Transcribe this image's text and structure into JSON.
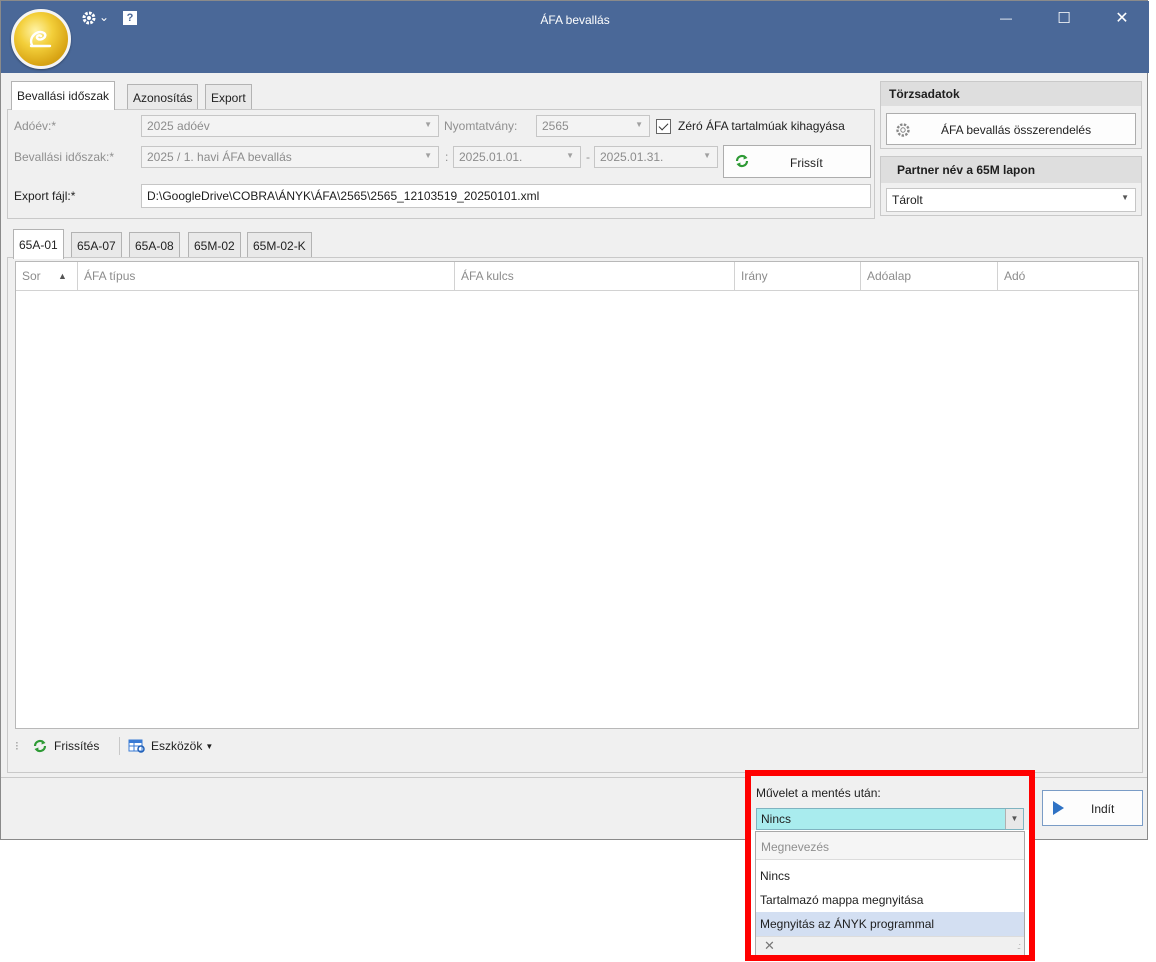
{
  "window": {
    "title": "ÁFA bevallás",
    "controls": {
      "minimize": "—",
      "maximize": "☐",
      "close": "✕"
    },
    "help_glyph": "?",
    "settings_caret": "⌄"
  },
  "top_tabs": [
    "Bevallási időszak",
    "Azonosítás",
    "Export"
  ],
  "form": {
    "adoev_label": "Adóév:*",
    "adoev_value": "2025 adóév",
    "nyomtatvany_label": "Nyomtatvány:",
    "nyomtatvany_value": "2565",
    "zero_afa_label": "Zéró ÁFA tartalmúak kihagyása",
    "zero_afa_checked": true,
    "idoszak_label": "Bevallási időszak:*",
    "idoszak_value": "2025 / 1. havi ÁFA bevallás",
    "colon_sep": ":",
    "date_from": "2025.01.01.",
    "dash_sep": "-",
    "date_to": "2025.01.31.",
    "refresh_button": "Frissít",
    "export_label": "Export fájl:*",
    "export_value": "D:\\GoogleDrive\\COBRA\\ÁNYK\\ÁFA\\2565\\2565_12103519_20250101.xml"
  },
  "torzsadatok": {
    "header": "Törzsadatok",
    "button": "ÁFA bevallás összerendelés"
  },
  "partner": {
    "header": "Partner név a 65M lapon",
    "value": "Tárolt"
  },
  "sheet_tabs": [
    "65A-01",
    "65A-07",
    "65A-08",
    "65M-02",
    "65M-02-K"
  ],
  "grid": {
    "columns": [
      "Sor",
      "ÁFA típus",
      "ÁFA kulcs",
      "Irány",
      "Adóalap",
      "Adó"
    ],
    "sort_indicator": "▲",
    "rows": []
  },
  "grid_toolbar": {
    "refresh": "Frissítés",
    "tools": "Eszközök"
  },
  "after_save": {
    "label": "Művelet a mentés után:",
    "selected": "Nincs",
    "dropdown_header": "Megnevezés",
    "options": [
      "Nincs",
      "Tartalmazó mappa megnyitása",
      "Megnyitás az ÁNYK programmal"
    ],
    "highlighted_option": "Megnyitás az ÁNYK programmal",
    "clear_glyph": "✕"
  },
  "start_button": "Indít",
  "colors": {
    "titlebar": "#4a6898",
    "highlight_frame": "#ff0000",
    "selected_field": "#a9ecee",
    "hover_option": "#d3dff2"
  }
}
